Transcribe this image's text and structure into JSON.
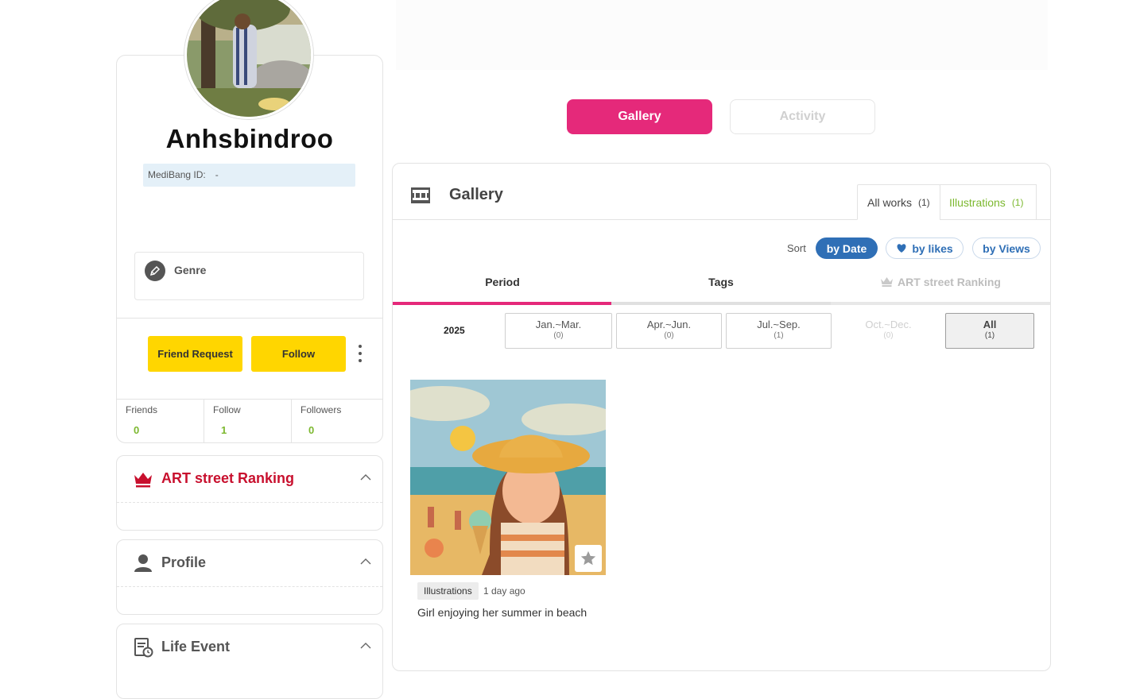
{
  "profile": {
    "username": "Anhsbindroo",
    "medibang_id_label": "MediBang ID:",
    "medibang_id_value": "-",
    "genre_label": "Genre",
    "friend_request_label": "Friend Request",
    "follow_label": "Follow",
    "stats": [
      {
        "label": "Friends",
        "value": "0"
      },
      {
        "label": "Follow",
        "value": "1"
      },
      {
        "label": "Followers",
        "value": "0"
      }
    ]
  },
  "sections": {
    "ranking": {
      "title": "ART street Ranking",
      "color": "#c8102e"
    },
    "profile": {
      "title": "Profile"
    },
    "life_event": {
      "title": "Life Event"
    }
  },
  "main_tabs": {
    "gallery": "Gallery",
    "activity": "Activity"
  },
  "gallery": {
    "title": "Gallery",
    "work_tabs": [
      {
        "label": "All works",
        "count": "(1)"
      },
      {
        "label": "Illustrations",
        "count": "(1)"
      }
    ],
    "sort": {
      "label": "Sort",
      "options": [
        "by Date",
        "by likes",
        "by Views"
      ],
      "selected": "by Date"
    },
    "sub_tabs": [
      "Period",
      "Tags",
      "ART street Ranking"
    ],
    "year": "2025",
    "quarters": [
      {
        "label": "Jan.~Mar.",
        "count": "(0)"
      },
      {
        "label": "Apr.~Jun.",
        "count": "(0)"
      },
      {
        "label": "Jul.~Sep.",
        "count": "(1)"
      },
      {
        "label": "Oct.~Dec.",
        "count": "(0)"
      },
      {
        "label": "All",
        "count": "(1)"
      }
    ],
    "works": [
      {
        "category": "Illustrations",
        "time_ago": "1 day ago",
        "title": "Girl enjoying her summer in beach"
      }
    ]
  },
  "colors": {
    "accent_pink": "#e5297a",
    "yellow": "#ffd600",
    "blue": "#2f6fb6",
    "green": "#7cb82f"
  }
}
